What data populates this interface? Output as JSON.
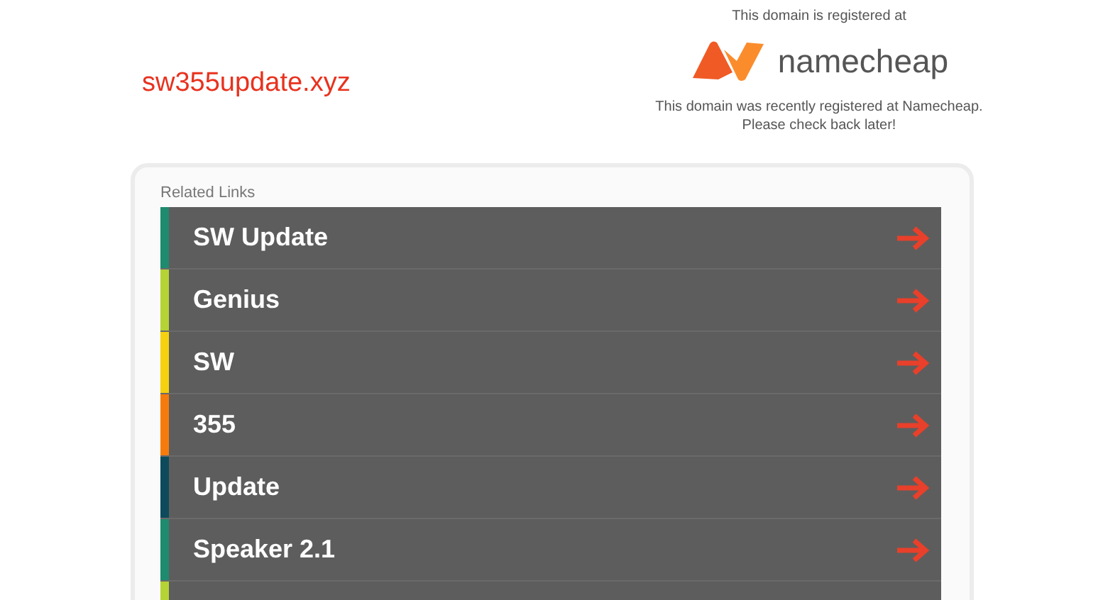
{
  "domain": "sw355update.xyz",
  "registrar": {
    "intro": "This domain is registered at",
    "name": "namecheap",
    "message": "This domain was recently registered at Namecheap.",
    "message_2": "Please check back later!"
  },
  "related": {
    "title": "Related Links",
    "links": [
      {
        "label": "SW Update",
        "color": "#1e8a6e"
      },
      {
        "label": "Genius",
        "color": "#b5d334"
      },
      {
        "label": "SW",
        "color": "#f5d10f"
      },
      {
        "label": "355",
        "color": "#f57c0c"
      },
      {
        "label": "Update",
        "color": "#0d4a5c"
      },
      {
        "label": "Speaker 2.1",
        "color": "#1e8a6e"
      },
      {
        "color": "#b5d334"
      }
    ]
  }
}
